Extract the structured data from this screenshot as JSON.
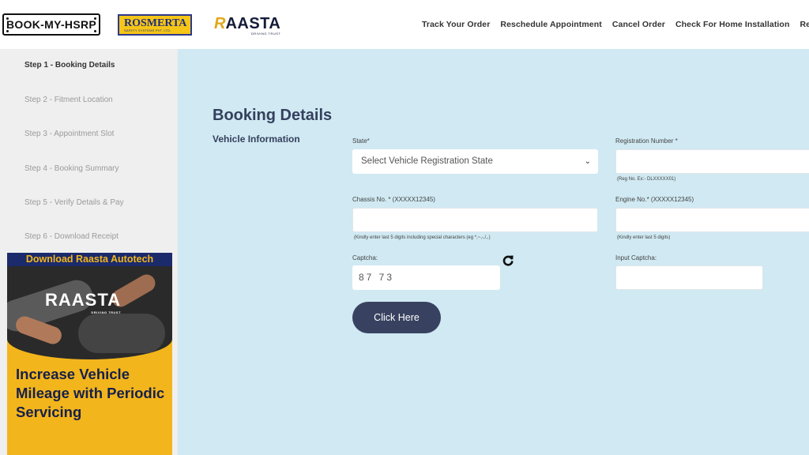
{
  "header": {
    "logo_hsrp": "BOOK-MY-HSRP",
    "logo_rosmerta": "OSMERTA",
    "logo_rosmerta_mark": "R",
    "logo_rosmerta_sub": "SAFETY SYSTEMS PVT. LTD.",
    "logo_raasta": "AASTA",
    "logo_raasta_mark": "R",
    "logo_raasta_sub": "DRIVING TRUST",
    "nav": [
      "Track Your Order",
      "Reschedule Appointment",
      "Cancel Order",
      "Check For Home Installation",
      "Receipt V"
    ]
  },
  "sidebar": {
    "steps": [
      "Step 1 - Booking Details",
      "Step 2 - Fitment Location",
      "Step 3 - Appointment Slot",
      "Step 4 - Booking Summary",
      "Step 5 - Verify Details & Pay",
      "Step 6 - Download Receipt"
    ],
    "active_step": "Step 1 - Booking Details",
    "promo": {
      "banner": "Download Raasta Autotech",
      "logo": "RAASTA",
      "logo_sub": "DRIVING TRUST",
      "text": "Increase Vehicle Mileage with Periodic Servicing"
    }
  },
  "main": {
    "title": "Booking Details",
    "section": "Vehicle Information",
    "state_label": "State*",
    "state_placeholder": "Select Vehicle Registration State",
    "reg_label": "Registration Number *",
    "reg_hint": "(Reg No. Ex:- DLXXXXX01)",
    "chassis_label": "Chassis No. * (XXXXX12345)",
    "chassis_hint": "(Kindly enter last 5 digits including special characters (eg *,~,-,/,.)",
    "engine_label": "Engine No.* (XXXXX12345)",
    "engine_hint": "(Kindly enter last 5 digits)",
    "captcha_label": "Captcha:",
    "captcha_value": "87 73",
    "input_captcha_label": "Input Captcha:",
    "button": "Click Here"
  },
  "colors": {
    "main_bg": "#d0e9f2",
    "sidebar_bg": "#efefef",
    "button_bg": "#384260",
    "promo_yellow": "#f3b51c",
    "promo_navy": "#1b2a6b"
  }
}
